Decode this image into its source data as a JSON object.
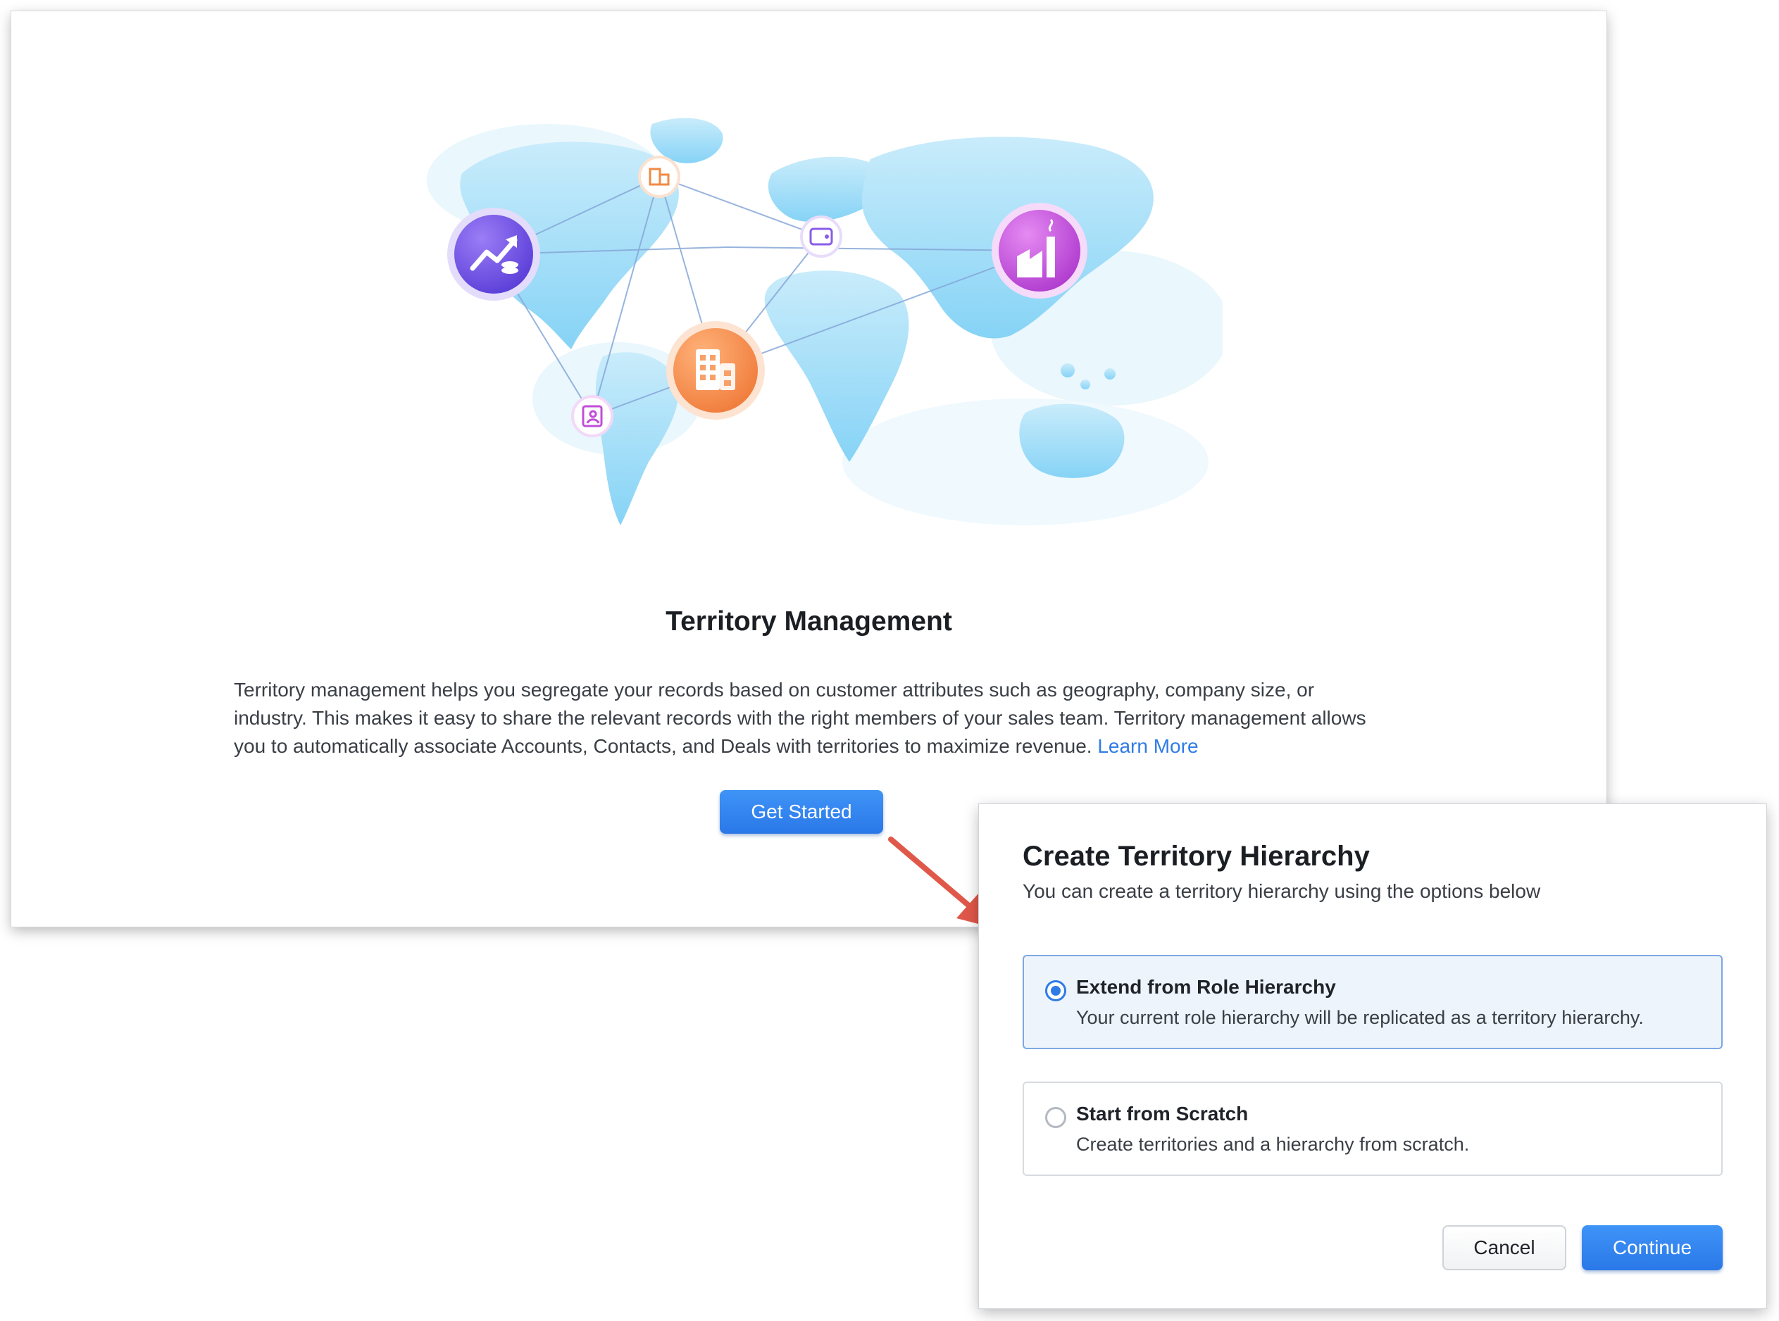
{
  "landing": {
    "title": "Territory Management",
    "description": "Territory management helps you segregate your records based on customer attributes such as geography, company size, or industry. This makes it easy to share the relevant records with the right members of your sales team. Territory management allows you to automatically associate Accounts, Contacts, and Deals with territories to maximize revenue.",
    "learn_more": "Learn More",
    "get_started_label": "Get Started",
    "illustration_icons": [
      "buildings-icon",
      "revenue-growth-icon",
      "wallet-icon",
      "factory-icon",
      "office-building-icon",
      "contacts-book-icon"
    ]
  },
  "dialog": {
    "title": "Create Territory Hierarchy",
    "subtitle": "You can create a territory hierarchy using the options below",
    "options": [
      {
        "label": "Extend from Role Hierarchy",
        "description": "Your current role hierarchy will be replicated as a territory hierarchy.",
        "selected": true
      },
      {
        "label": "Start from Scratch",
        "description": "Create territories and a hierarchy from scratch.",
        "selected": false
      }
    ],
    "cancel_label": "Cancel",
    "continue_label": "Continue"
  },
  "colors": {
    "primary": "#2f7be6",
    "arrow": "#e0584a",
    "map": "#aee1f9",
    "selected_bg": "#eef4fc"
  }
}
